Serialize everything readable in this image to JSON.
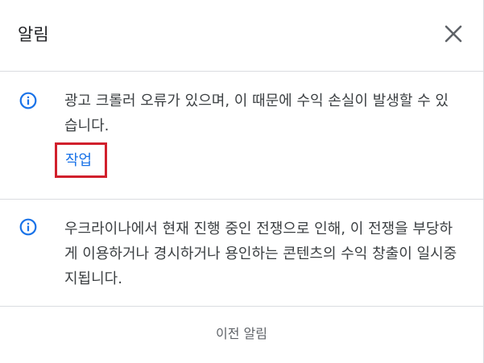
{
  "header": {
    "title": "알림",
    "close_icon": "close-icon"
  },
  "notices": [
    {
      "icon": "info-icon",
      "text": "광고 크롤러 오류가 있으며, 이 때문에 수익 손실이 발생할 수 있습니다.",
      "action_label": "작업"
    },
    {
      "icon": "info-icon",
      "text": "우크라이나에서 현재 진행 중인 전쟁으로 인해, 이 전쟁을 부당하게 이용하거나 경시하거나 용인하는 콘텐츠의 수익 창출이 일시중지됩니다."
    }
  ],
  "footer": {
    "previous_label": "이전 알림"
  },
  "colors": {
    "info_icon": "#1a73e8",
    "link": "#1a73e8",
    "highlight_border": "#d1202c",
    "divider": "#dadce0"
  }
}
